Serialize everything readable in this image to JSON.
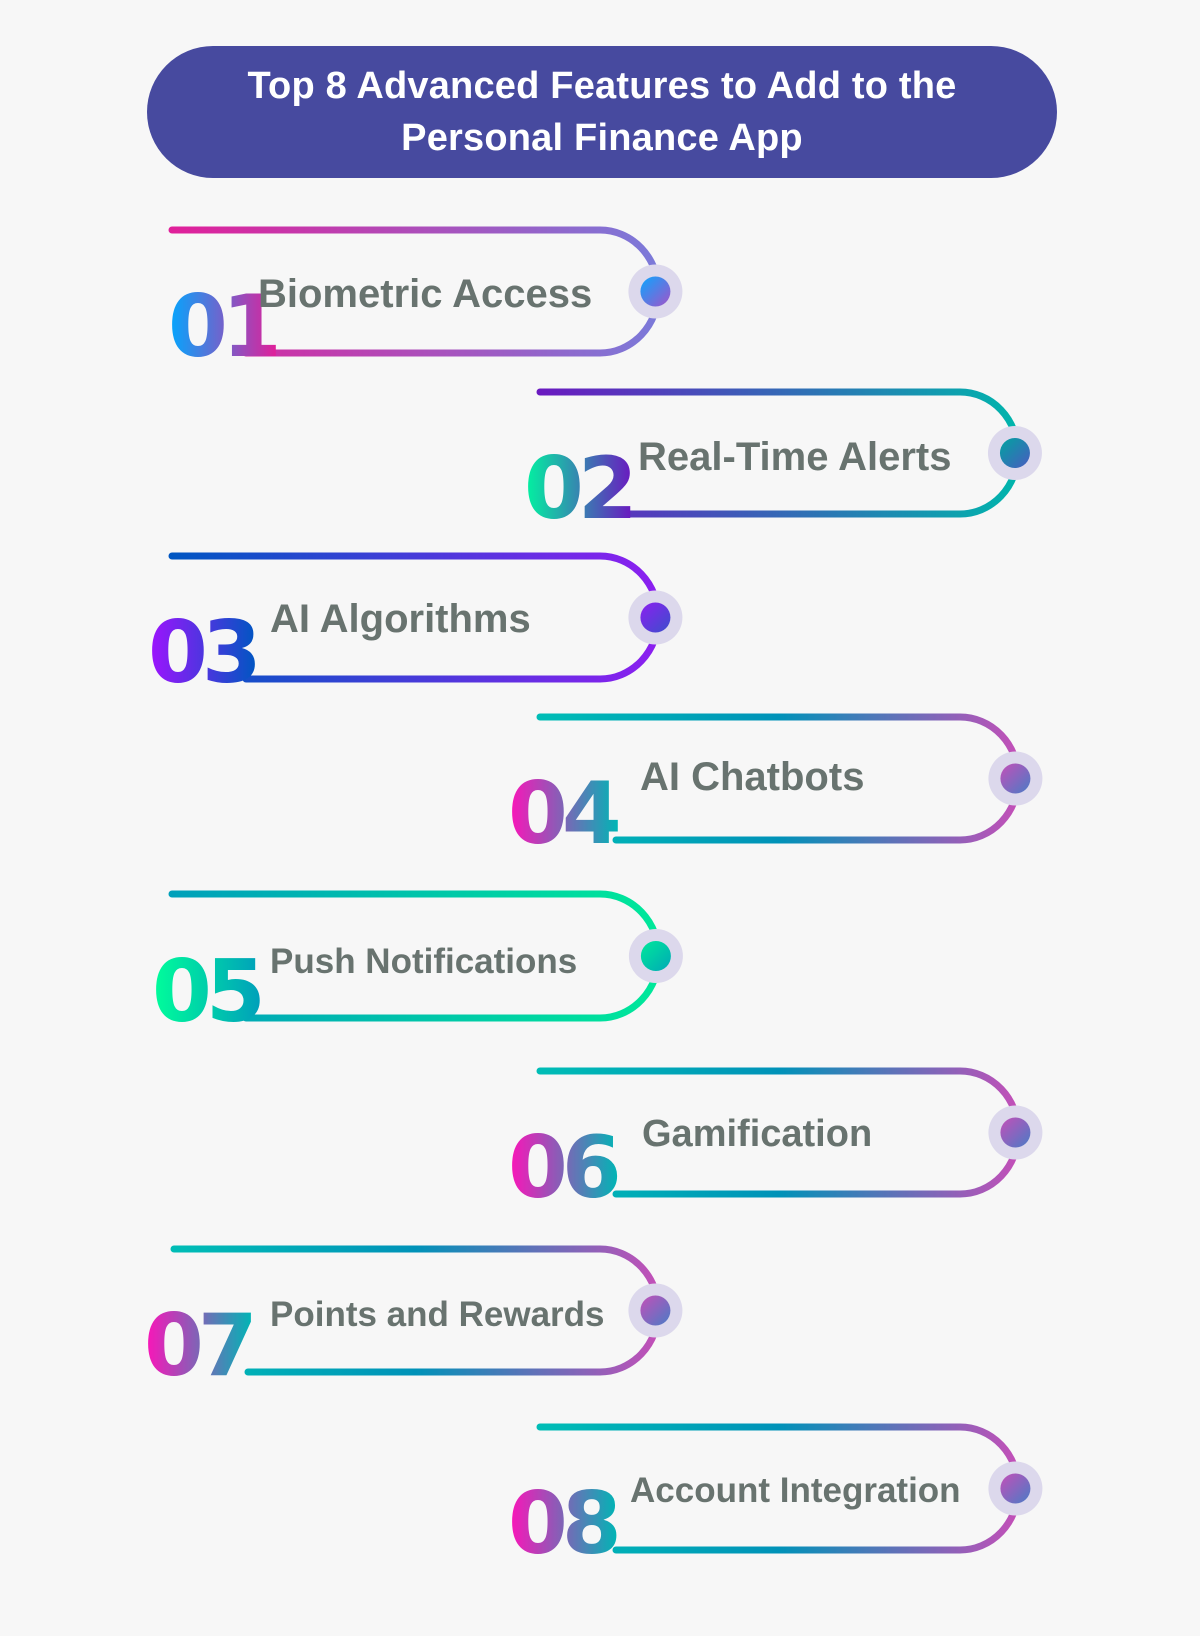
{
  "header": {
    "title": "Top 8 Advanced Features to Add to the Personal Finance App",
    "background_color": "#474a9f",
    "text_color": "#ffffff"
  },
  "colors": {
    "background": "#f7f7f7",
    "label_text": "#68736f",
    "node_halo": "#dcd8ec"
  },
  "items": [
    {
      "number": "01",
      "label": "Biometric Access",
      "side": "left",
      "line_gradient": [
        "#e0209a",
        "#7b7ad9"
      ],
      "number_gradient": [
        "#00a8ff",
        "#e0209a"
      ],
      "dot_gradient": [
        "#0aa6ff",
        "#a353c9"
      ]
    },
    {
      "number": "02",
      "label": "Real-Time Alerts",
      "side": "right",
      "line_gradient": [
        "#6a1ac0",
        "#00b5ac"
      ],
      "number_gradient": [
        "#00f5a0",
        "#6a1ac0"
      ],
      "dot_gradient": [
        "#00a3a0",
        "#4a5bc0"
      ]
    },
    {
      "number": "03",
      "label": "AI Algorithms",
      "side": "left",
      "line_gradient": [
        "#0056c2",
        "#8c1ff0"
      ],
      "number_gradient": [
        "#a012ff",
        "#0056c2"
      ],
      "dot_gradient": [
        "#8c1ff0",
        "#3b4fcc"
      ]
    },
    {
      "number": "04",
      "label": "AI Chatbots",
      "side": "right",
      "line_gradient": [
        "#00bdb6",
        "#0092b8",
        "#c44fb8"
      ],
      "number_gradient": [
        "#ff12b8",
        "#00b5b5"
      ],
      "dot_gradient": [
        "#c44fb8",
        "#4a7cc6"
      ]
    },
    {
      "number": "05",
      "label": "Push Notifications",
      "side": "left",
      "line_gradient": [
        "#00a0ba",
        "#00e89a"
      ],
      "number_gradient": [
        "#00ff9a",
        "#00a0ba"
      ],
      "dot_gradient": [
        "#00e89a",
        "#00a9b6"
      ]
    },
    {
      "number": "06",
      "label": "Gamification",
      "side": "right",
      "line_gradient": [
        "#00bdb6",
        "#0092b8",
        "#c44fb8"
      ],
      "number_gradient": [
        "#ff12b8",
        "#00b5b5"
      ],
      "dot_gradient": [
        "#c44fb8",
        "#4a7cc6"
      ]
    },
    {
      "number": "07",
      "label": "Points and Rewards",
      "side": "left",
      "line_gradient": [
        "#00bdb6",
        "#0092b8",
        "#c44fb8"
      ],
      "number_gradient": [
        "#ff12b8",
        "#00b5b5"
      ],
      "dot_gradient": [
        "#c44fb8",
        "#4a7cc6"
      ]
    },
    {
      "number": "08",
      "label": "Account Integration",
      "side": "right",
      "line_gradient": [
        "#00bdb6",
        "#0092b8",
        "#c44fb8"
      ],
      "number_gradient": [
        "#ff12b8",
        "#00b5b5"
      ],
      "dot_gradient": [
        "#c44fb8",
        "#4a7cc6"
      ]
    }
  ]
}
